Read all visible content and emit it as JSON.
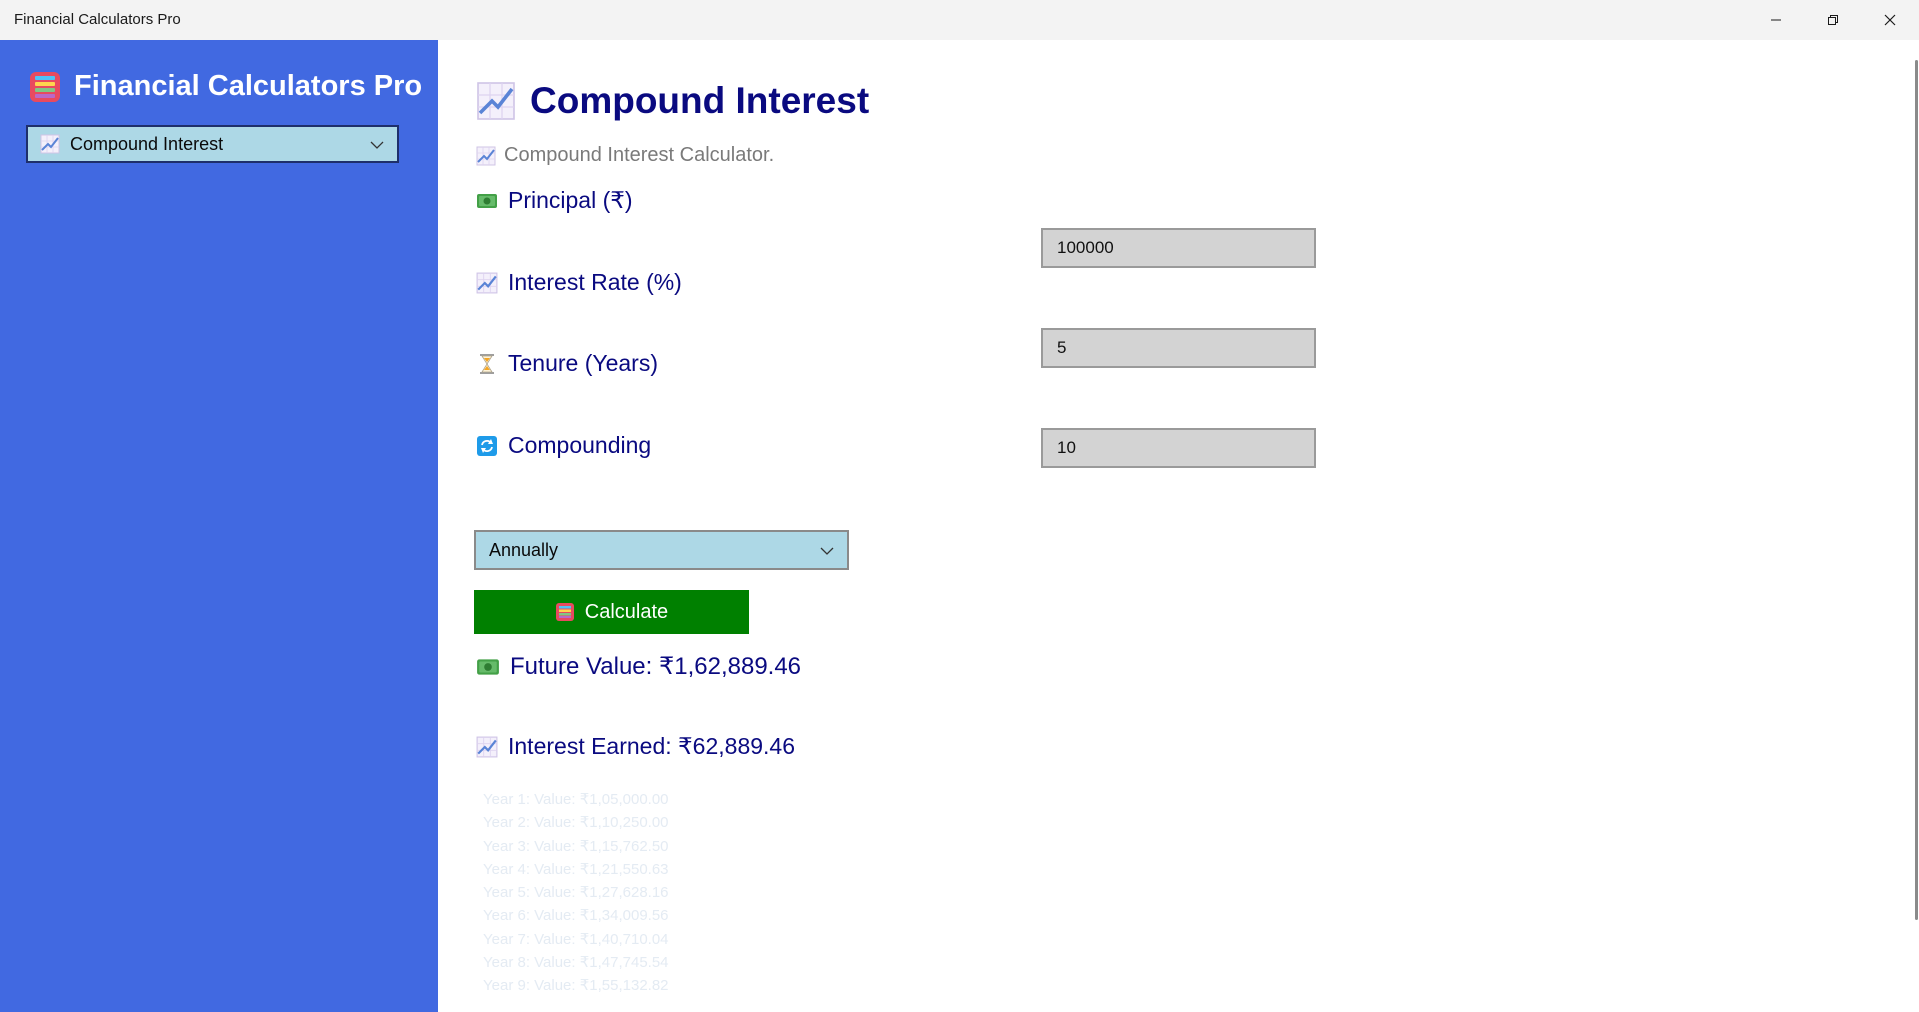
{
  "window": {
    "title": "Financial Calculators Pro",
    "controls": {
      "minimize": "minimize-icon",
      "maximize": "restore-icon",
      "close": "close-icon"
    }
  },
  "sidebar": {
    "app_title": "Financial Calculators Pro",
    "app_icon": "abacus-icon",
    "calculator_select": {
      "selected": "Compound Interest",
      "icon": "chart-increasing-icon"
    }
  },
  "main": {
    "page_title": "Compound Interest",
    "subtitle": "Compound Interest Calculator.",
    "fields": {
      "principal": {
        "label": "Principal (₹)",
        "icon": "banknote-icon",
        "value": "100000"
      },
      "rate": {
        "label": "Interest Rate (%)",
        "icon": "chart-increasing-icon",
        "value": "5"
      },
      "tenure": {
        "label": "Tenure (Years)",
        "icon": "hourglass-icon",
        "value": "10"
      },
      "compounding": {
        "label": "Compounding",
        "icon": "refresh-icon",
        "selected": "Annually"
      }
    },
    "calculate_button": {
      "label": "Calculate",
      "icon": "abacus-icon"
    },
    "results": {
      "future_value": "Future Value: ₹1,62,889.46",
      "interest_earned": "Interest Earned: ₹62,889.46"
    },
    "yearly_breakdown": [
      "Year 1: Value: ₹1,05,000.00",
      "Year 2: Value: ₹1,10,250.00",
      "Year 3: Value: ₹1,15,762.50",
      "Year 4: Value: ₹1,21,550.63",
      "Year 5: Value: ₹1,27,628.16",
      "Year 6: Value: ₹1,34,009.56",
      "Year 7: Value: ₹1,40,710.04",
      "Year 8: Value: ₹1,47,745.54",
      "Year 9: Value: ₹1,55,132.82"
    ]
  },
  "colors": {
    "sidebar_bg": "#4169e1",
    "accent_text": "#0a0a80",
    "input_bg": "#d3d3d3",
    "select_bg": "#add8e6",
    "button_bg": "#008000"
  }
}
